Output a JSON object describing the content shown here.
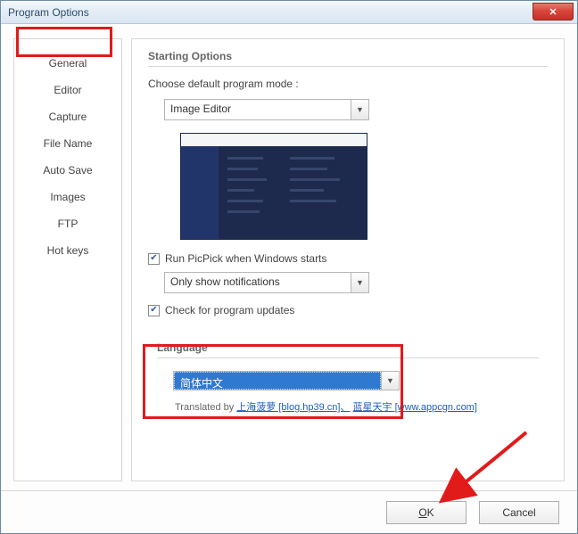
{
  "window": {
    "title": "Program Options"
  },
  "sidebar": {
    "items": [
      {
        "label": "General"
      },
      {
        "label": "Editor"
      },
      {
        "label": "Capture"
      },
      {
        "label": "File Name"
      },
      {
        "label": "Auto Save"
      },
      {
        "label": "Images"
      },
      {
        "label": "FTP"
      },
      {
        "label": "Hot keys"
      }
    ],
    "active_index": 0
  },
  "main": {
    "starting_options_title": "Starting Options",
    "choose_mode_label": "Choose default program mode :",
    "mode_select": {
      "value": "Image Editor"
    },
    "run_on_startup": {
      "checked": true,
      "label": "Run PicPick when Windows starts"
    },
    "startup_behavior_select": {
      "value": "Only show notifications"
    },
    "check_updates": {
      "checked": true,
      "label": "Check for program updates"
    },
    "language_section_title": "Language",
    "language_select": {
      "value": "简体中文"
    },
    "translated_by_prefix": "Translated by  ",
    "translator_1": "上海菠萝 [blog.hp39.cn]、",
    "translator_2": "蓝星天宇 [www.appcgn.com]"
  },
  "footer": {
    "ok_label": "OK",
    "cancel_label": "Cancel"
  }
}
